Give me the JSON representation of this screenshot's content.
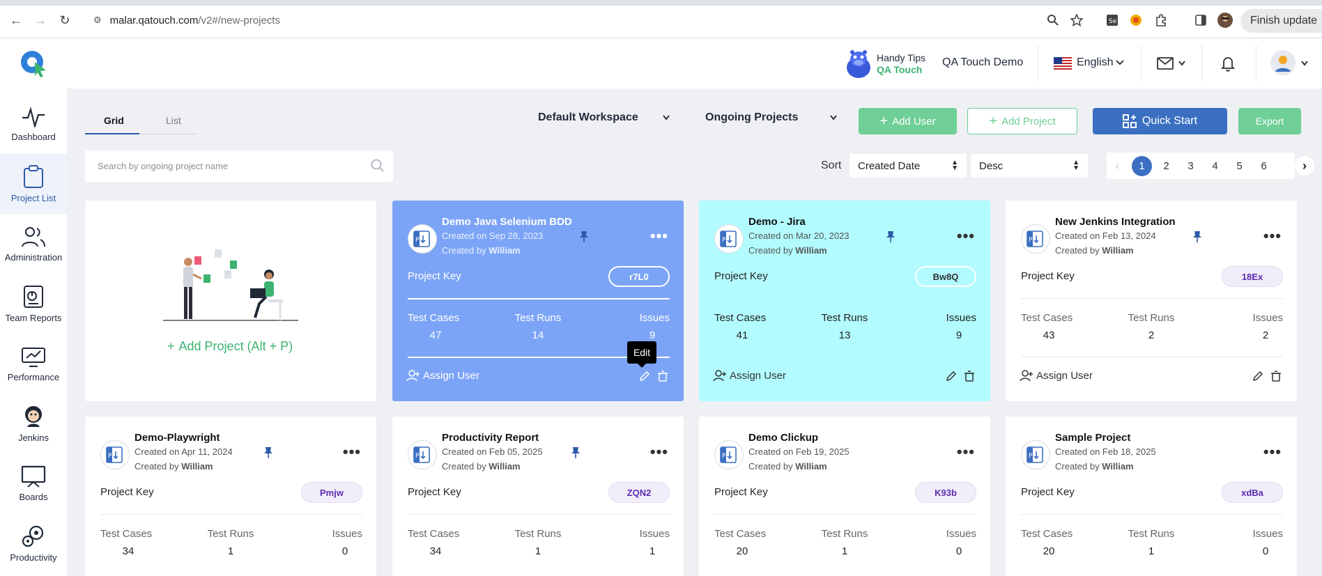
{
  "browser": {
    "url_domain": "malar.qatouch.com",
    "url_path": "/v2#/new-projects",
    "finish_update": "Finish update"
  },
  "header": {
    "tips_line1": "Handy Tips",
    "tips_line2": "QA Touch",
    "company": "QA Touch Demo",
    "language": "English"
  },
  "sidebar": {
    "items": [
      {
        "label": "Dashboard",
        "icon": "pulse-icon"
      },
      {
        "label": "Project List",
        "icon": "clipboard-icon"
      },
      {
        "label": "Administration",
        "icon": "users-icon"
      },
      {
        "label": "Team Reports",
        "icon": "report-icon"
      },
      {
        "label": "Performance",
        "icon": "performance-icon"
      },
      {
        "label": "Jenkins",
        "icon": "jenkins-icon"
      },
      {
        "label": "Boards",
        "icon": "board-icon"
      },
      {
        "label": "Productivity",
        "icon": "gear-icon"
      }
    ]
  },
  "toolbar": {
    "tab_grid": "Grid",
    "tab_list": "List",
    "workspace": "Default Workspace",
    "project_filter": "Ongoing Projects",
    "add_user": "Add User",
    "add_project": "Add Project",
    "quick_start": "Quick Start",
    "export": "Export"
  },
  "search": {
    "placeholder": "Search by ongoing project name"
  },
  "sort": {
    "label": "Sort",
    "field": "Created Date",
    "order": "Desc"
  },
  "pagination": {
    "pages": [
      "1",
      "2",
      "3",
      "4",
      "5",
      "6"
    ],
    "current": "1"
  },
  "add_card": {
    "label": "Add Project (Alt + P)"
  },
  "labels": {
    "project_key": "Project Key",
    "test_cases": "Test Cases",
    "test_runs": "Test Runs",
    "issues": "Issues",
    "assign_user": "Assign User",
    "created_by_prefix": "Created by",
    "tooltip_edit": "Edit"
  },
  "projects": [
    {
      "title": "Demo Java Selenium BDD",
      "created": "Created on Sep 28, 2023",
      "by": "William",
      "key": "r7L0",
      "test_cases": "47",
      "test_runs": "14",
      "issues": "9",
      "pinned": true,
      "theme": "blue"
    },
    {
      "title": "Demo - Jira",
      "created": "Created on Mar 20, 2023",
      "by": "William",
      "key": "Bw8Q",
      "test_cases": "41",
      "test_runs": "13",
      "issues": "9",
      "pinned": true,
      "theme": "cyan"
    },
    {
      "title": "New Jenkins Integration",
      "created": "Created on Feb 13, 2024",
      "by": "William",
      "key": "18Ex",
      "test_cases": "43",
      "test_runs": "2",
      "issues": "2",
      "pinned": true,
      "theme": "white"
    },
    {
      "title": "Demo-Playwright",
      "created": "Created on Apr 11, 2024",
      "by": "William",
      "key": "Pmjw",
      "test_cases": "34",
      "test_runs": "1",
      "issues": "0",
      "pinned": true,
      "theme": "white"
    },
    {
      "title": "Productivity Report",
      "created": "Created on Feb 05, 2025",
      "by": "William",
      "key": "ZQN2",
      "test_cases": "34",
      "test_runs": "1",
      "issues": "1",
      "pinned": true,
      "theme": "white"
    },
    {
      "title": "Demo Clickup",
      "created": "Created on Feb 19, 2025",
      "by": "William",
      "key": "K93b",
      "test_cases": "20",
      "test_runs": "1",
      "issues": "0",
      "pinned": false,
      "theme": "white"
    },
    {
      "title": "Sample Project",
      "created": "Created on Feb 18, 2025",
      "by": "William",
      "key": "xdBa",
      "test_cases": "20",
      "test_runs": "1",
      "issues": "0",
      "pinned": false,
      "theme": "white"
    }
  ],
  "colors": {
    "accent_blue": "#3b6fc2",
    "accent_green": "#6fcf97",
    "card_blue": "#7ca4f6",
    "card_cyan": "#b2fbff"
  }
}
